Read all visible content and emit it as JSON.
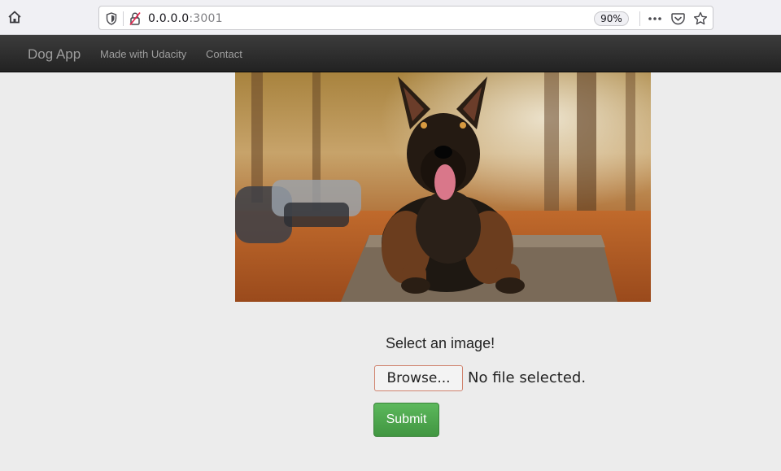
{
  "browser": {
    "url_host": "0.0.0.0",
    "url_port": ":3001",
    "zoom": "90%"
  },
  "navbar": {
    "brand": "Dog App",
    "links": [
      "Made with Udacity",
      "Contact"
    ]
  },
  "hero": {
    "image": "dog-photo"
  },
  "form": {
    "prompt": "Select an image!",
    "browse_label": "Browse...",
    "file_status": "No file selected.",
    "submit_label": "Submit"
  },
  "colors": {
    "navbar": "#222222",
    "submit": "#5cb85c",
    "background": "#ececec"
  }
}
